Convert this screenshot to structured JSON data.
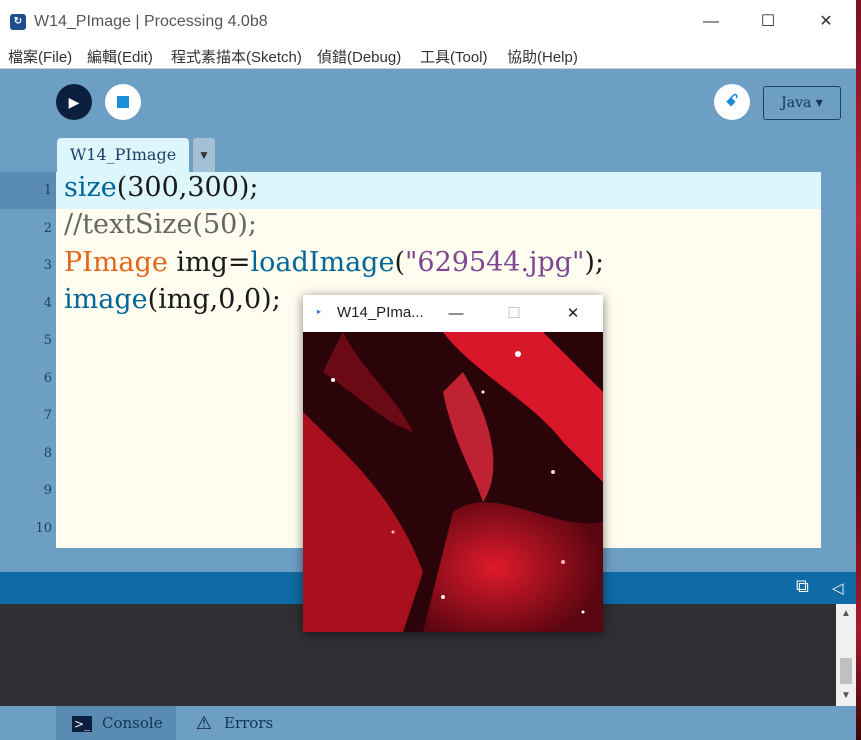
{
  "titlebar": {
    "app_icon_name": "processing-icon",
    "title": "W14_PImage | Processing 4.0b8",
    "minimize": "—",
    "maximize": "☐",
    "close": "✕"
  },
  "menu": {
    "items": [
      "檔案(File)",
      "編輯(Edit)",
      "程式素描本(Sketch)",
      "偵錯(Debug)",
      "工具(Tool)",
      "協助(Help)"
    ]
  },
  "toolbar": {
    "run_icon": "▶",
    "debug_icon": "ꗃ",
    "mode_label": "Java ▾"
  },
  "tabs": {
    "active": "W14_PImage",
    "menu_arrow": "▼"
  },
  "editor": {
    "line_numbers": [
      "1",
      "2",
      "3",
      "4",
      "5",
      "6",
      "7",
      "8",
      "9",
      "10"
    ],
    "code": {
      "l1_fn": "size",
      "l1_rest": "(300,300);",
      "l2_comment": "//textSize(50);",
      "l3_type": "PImage",
      "l3_mid": " img=",
      "l3_fn": "loadImage",
      "l3_open": "(",
      "l3_str": "\"629544.jpg\"",
      "l3_close": ");",
      "l4_fn": "image",
      "l4_rest": "(img,0,0);"
    }
  },
  "status": {
    "console_toggle_icon": "⧉",
    "collapse_icon": "◁"
  },
  "console_scroll": {
    "up": "▲",
    "down": "▼"
  },
  "footer": {
    "console_label": "Console",
    "errors_label": "Errors",
    "console_icon_glyph": ">_",
    "errors_icon_glyph": "⚠"
  },
  "sketch_window": {
    "icon": "▸",
    "title": "W14_PIma...",
    "minimize": "—",
    "maximize": "☐",
    "close": "✕"
  }
}
